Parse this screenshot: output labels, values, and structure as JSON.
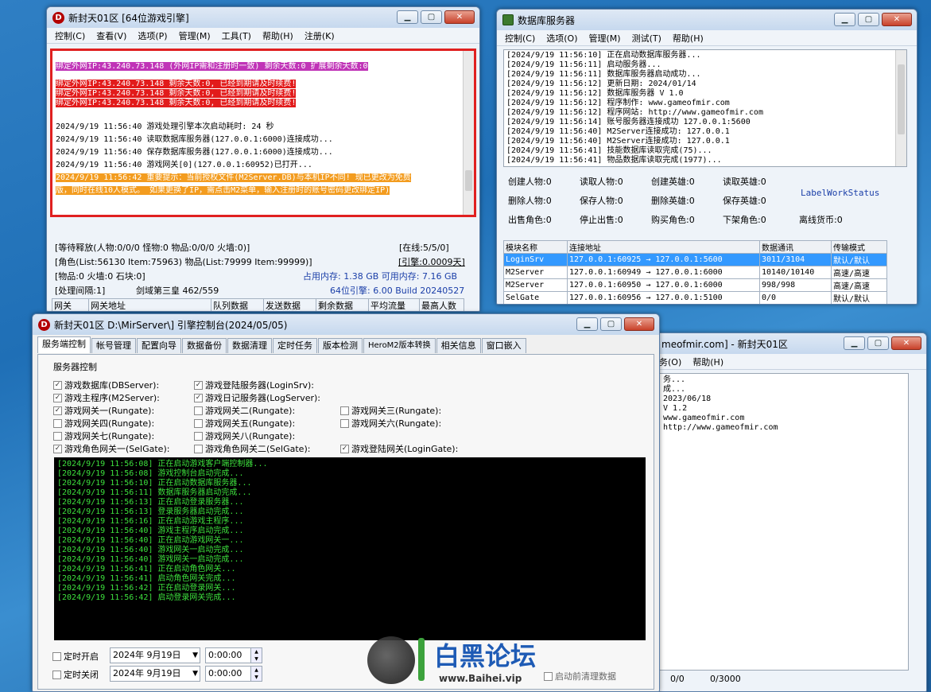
{
  "w1": {
    "title": "新封天01区 [64位游戏引擎]",
    "menu": [
      "控制(C)",
      "查看(V)",
      "选项(P)",
      "管理(M)",
      "工具(T)",
      "帮助(H)",
      "注册(K)"
    ],
    "logs": [
      {
        "t": "绑定外网IP:43.240.73.148 (外网IP需和注册时一致) 剩余天数:0 扩展剩余天数:0",
        "c": "m"
      },
      {
        "t": "",
        "c": ""
      },
      {
        "t": "绑定外网IP:43.240.73.148 剩余天数:0, 已经到期请及时续费!",
        "c": "r"
      },
      {
        "t": "绑定外网IP:43.240.73.148 剩余天数:0, 已经到期请及时续费!",
        "c": "r"
      },
      {
        "t": "绑定外网IP:43.240.73.148 剩余天数:0, 已经到期请及时续费!",
        "c": "r"
      },
      {
        "t": "",
        "c": ""
      },
      {
        "t": "2024/9/19 11:56:40 游戏处理引擎本次启动耗时: 24 秒",
        "c": ""
      },
      {
        "t": "2024/9/19 11:56:40 读取数据库服务器(127.0.0.1:6000)连接成功...",
        "c": ""
      },
      {
        "t": "2024/9/19 11:56:40 保存数据库服务器(127.0.0.1:6000)连接成功...",
        "c": ""
      },
      {
        "t": "2024/9/19 11:56:40 游戏网关[0](127.0.0.1:60952)已打开...",
        "c": ""
      },
      {
        "t": "2024/9/19 11:56:42 重要提示：当前授权文件(M2Server.DB)与本机IP不同! 现已更改为免费",
        "c": "o"
      },
      {
        "t": "版，同时在线10人模式。 如果更换了IP，需点击M2菜单，输入注册时的账号密码更改绑定IP)",
        "c": "o"
      }
    ],
    "stat_release": "[等待释放(人物:0/0/0 怪物:0 物品:0/0/0 火墙:0)]",
    "online": "[在线:5/5/0]",
    "role_list": "[角色(List:56130 Item:75963) 物品(List:79999 Item:99999)]",
    "engine_ver_box": "[引擎:0.0009天]",
    "items": "[物品:0 火墙:0 石块:0]",
    "mem": "占用内存: 1.38 GB 可用内存: 7.16 GB",
    "interval": "[处理间隔:1]",
    "server_name": "剑域第三皇 462/559",
    "build": "64位引擎: 6.00 Build 20240527",
    "grid_head": [
      "网关",
      "网关地址",
      "队列数据",
      "发送数据",
      "剩余数据",
      "平均流量",
      "最高人数"
    ]
  },
  "w2": {
    "title": "数据库服务器",
    "menu": [
      "控制(C)",
      "选项(O)",
      "管理(M)",
      "测试(T)",
      "帮助(H)"
    ],
    "logs": [
      "[2024/9/19 11:56:10] 正在启动数据库服务器...",
      "[2024/9/19 11:56:11] 启动服务器...",
      "[2024/9/19 11:56:11] 数据库服务器启动成功...",
      "[2024/9/19 11:56:12] 更新日期: 2024/01/14",
      "[2024/9/19 11:56:12] 数据库服务器 V 1.0",
      "[2024/9/19 11:56:12] 程序制作: www.gameofmir.com",
      "[2024/9/19 11:56:12] 程序网站: http://www.gameofmir.com",
      "[2024/9/19 11:56:14] 账号服务器连接成功 127.0.0.1:5600",
      "[2024/9/19 11:56:40] M2Server连接成功: 127.0.0.1",
      "[2024/9/19 11:56:40] M2Server连接成功: 127.0.0.1",
      "[2024/9/19 11:56:41] 技能数据库读取完成(75)...",
      "[2024/9/19 11:56:41] 物品数据库读取完成(1977)..."
    ],
    "stats": [
      [
        "创建人物:0",
        "读取人物:0",
        "创建英雄:0",
        "读取英雄:0"
      ],
      [
        "删除人物:0",
        "保存人物:0",
        "删除英雄:0",
        "保存英雄:0"
      ],
      [
        "出售角色:0",
        "停止出售:0",
        "购买角色:0",
        "下架角色:0"
      ]
    ],
    "label_status": "LabelWorkStatus",
    "offline": "离线货币:0",
    "grid_head": [
      "模块名称",
      "连接地址",
      "数据通讯",
      "传输模式"
    ],
    "grid": [
      [
        "LoginSrv",
        "127.0.0.1:60925 → 127.0.0.1:5600",
        "3011/3104",
        "默认/默认"
      ],
      [
        "M2Server",
        "127.0.0.1:60949 → 127.0.0.1:6000",
        "10140/10140",
        "高速/高速"
      ],
      [
        "M2Server",
        "127.0.0.1:60950 → 127.0.0.1:6000",
        "998/998",
        "高速/高速"
      ],
      [
        "SelGate",
        "127.0.0.1:60956 → 127.0.0.1:5100",
        "0/0",
        "默认/默认"
      ]
    ]
  },
  "w4": {
    "title": "meofmir.com] - 新封天01区",
    "menu": [
      "务(O)",
      "帮助(H)"
    ],
    "lines": [
      "务...",
      "成...",
      "2023/06/18",
      "V 1.2",
      "www.gameofmir.com",
      "http://www.gameofmir.com"
    ],
    "bottom": [
      "0/0",
      "0/3000"
    ]
  },
  "w3": {
    "title": "新封天01区 D:\\MirServer\\] 引擎控制台(2024/05/05)",
    "tabs": [
      "服务端控制",
      "帐号管理",
      "配置向导",
      "数据备份",
      "数据清理",
      "定时任务",
      "版本检测",
      "HeroM2版本转换",
      "相关信息",
      "窗口嵌入"
    ],
    "group": "服务器控制",
    "checks": [
      {
        "l": "游戏数据库(DBServer):",
        "v": "✓"
      },
      {
        "l": "游戏登陆服务器(LoginSrv):",
        "v": "✓"
      },
      {
        "l": "游戏主程序(M2Server):",
        "v": "✓"
      },
      {
        "l": "游戏日记服务器(LogServer):",
        "v": "✓"
      },
      {
        "l": "游戏网关一(Rungate):",
        "v": "✓"
      },
      {
        "l": "游戏网关二(Rungate):",
        "v": ""
      },
      {
        "l": "游戏网关三(Rungate):",
        "v": ""
      },
      {
        "l": "游戏网关四(Rungate):",
        "v": ""
      },
      {
        "l": "游戏网关五(Rungate):",
        "v": ""
      },
      {
        "l": "游戏网关六(Rungate):",
        "v": ""
      },
      {
        "l": "游戏网关七(Rungate):",
        "v": ""
      },
      {
        "l": "游戏网关八(Rungate):",
        "v": ""
      },
      {
        "l": "游戏角色网关一(SelGate):",
        "v": "✓"
      },
      {
        "l": "游戏角色网关二(SelGate):",
        "v": ""
      },
      {
        "l": "游戏登陆网关(LoginGate):",
        "v": "✓"
      }
    ],
    "console": [
      "[2024/9/19 11:56:08] 正在启动游戏客户端控制器...",
      "[2024/9/19 11:56:08] 游戏控制台启动完成...",
      "[2024/9/19 11:56:10] 正在启动数据库服务器...",
      "[2024/9/19 11:56:11] 数据库服务器启动完成...",
      "[2024/9/19 11:56:13] 正在启动登录服务器...",
      "[2024/9/19 11:56:13] 登录服务器启动完成...",
      "[2024/9/19 11:56:16] 正在启动游戏主程序...",
      "[2024/9/19 11:56:40] 游戏主程序启动完成...",
      "[2024/9/19 11:56:40] 正在启动游戏网关一...",
      "[2024/9/19 11:56:40] 游戏网关一启动完成...",
      "[2024/9/19 11:56:40] 游戏网关一启动完成...",
      "[2024/9/19 11:56:41] 正在启动角色网关...",
      "[2024/9/19 11:56:41] 启动角色网关完成...",
      "[2024/9/19 11:56:42] 正在启动登录网关...",
      "[2024/9/19 11:56:42] 启动登录网关完成..."
    ],
    "timer_open": "定时开启",
    "timer_close": "定时关闭",
    "date": "2024年 9月19日",
    "time": "0:00:00",
    "clear": "启动前清理数据"
  },
  "watermark": {
    "brand1": "白黑",
    "brand2": "论坛",
    "url": "www.Baihei.vip"
  }
}
